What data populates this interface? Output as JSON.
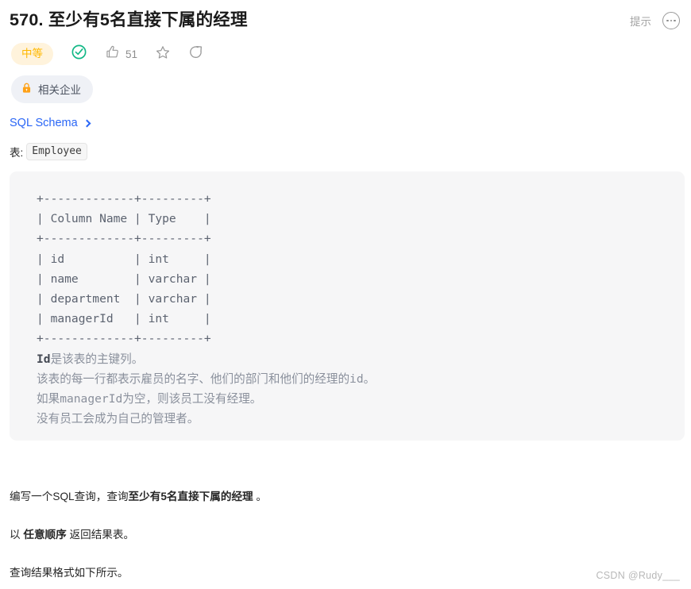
{
  "header": {
    "title": "570. 至少有5名直接下属的经理",
    "hint_label": "提示",
    "more_icon": "ellipsis-circle-icon"
  },
  "meta": {
    "difficulty": "中等",
    "solved_icon": "check-circle-icon",
    "like_icon": "thumbs-up-icon",
    "like_count": "51",
    "favorite_icon": "star-icon",
    "share_icon": "share-icon",
    "company_tag": {
      "lock_icon": "lock-icon",
      "label": "相关企业"
    }
  },
  "schema": {
    "link_label": "SQL Schema",
    "chevron_icon": "chevron-right-icon"
  },
  "table_section": {
    "prefix": "表:",
    "table_name": "Employee"
  },
  "code_block": {
    "schema_ascii": "+-------------+---------+\n| Column Name | Type    |\n+-------------+---------+\n| id          | int     |\n| name        | varchar |\n| department  | varchar |\n| managerId   | int     |\n+-------------+---------+",
    "notes": [
      {
        "bold_prefix": "Id",
        "text": "是该表的主键列。"
      },
      {
        "bold_prefix": "",
        "text": "该表的每一行都表示雇员的名字、他们的部门和他们的经理的id。"
      },
      {
        "bold_prefix": "",
        "text": "如果managerId为空，则该员工没有经理。"
      },
      {
        "bold_prefix": "",
        "text": "没有员工会成为自己的管理者。"
      }
    ]
  },
  "description": {
    "p1_before": "编写一个SQL查询，查询",
    "p1_bold": "至少有5名直接下属的经理",
    "p1_after": " 。",
    "p2_before": "以 ",
    "p2_bold": "任意顺序",
    "p2_after": " 返回结果表。",
    "p3": "查询结果格式如下所示。"
  },
  "watermark": "CSDN @Rudy___",
  "colors": {
    "accent_blue": "#2a66f6",
    "difficulty_bg": "#fff3dc",
    "difficulty_text": "#ffb800",
    "solved_green": "#00af9b",
    "lock_orange": "#ffa116",
    "code_bg": "#f6f6f7",
    "tag_bg": "#eff1f6"
  }
}
